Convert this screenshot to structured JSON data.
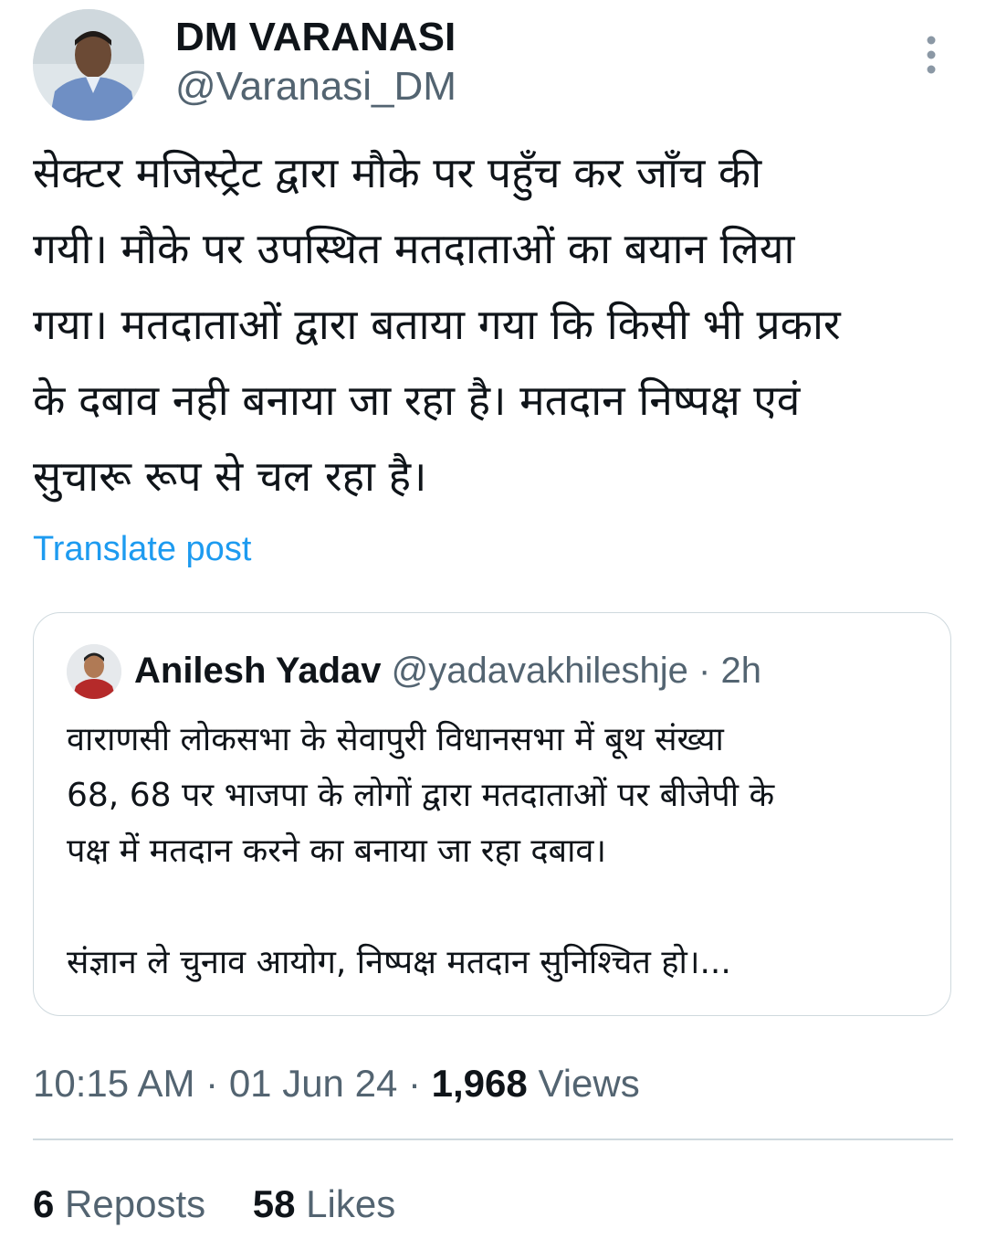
{
  "tweet": {
    "author": {
      "display_name": "DM VARANASI",
      "handle": "@Varanasi_DM",
      "avatar_icon": "profile-photo-icon"
    },
    "more_icon": "more-vertical-icon",
    "text": "सेक्टर मजिस्ट्रेट द्वारा मौके पर पहुँच कर जाँच की\nगयी। मौके पर उपस्थित मतदाताओं का बयान लिया\nगया। मतदाताओं द्वारा बताया गया कि किसी भी प्रकार\nके दबाव नही बनाया जा रहा है। मतदान निष्पक्ष एवं\nसुचारू रूप से चल रहा है।",
    "translate_label": "Translate post",
    "link_color": "#1d9bf0",
    "quoted": {
      "author_name": "Anilesh Yadav",
      "handle": "@yadavakhileshje",
      "separator": "·",
      "time": "2h",
      "avatar_icon": "profile-photo-icon",
      "text": "वाराणसी लोकसभा के सेवापुरी विधानसभा में बूथ संख्या\n68, 68 पर भाजपा के लोगों द्वारा मतदाताओं पर बीजेपी के\nपक्ष में मतदान करने का बनाया जा रहा दबाव।\n\nसंज्ञान ले चुनाव आयोग, निष्पक्ष मतदान सुनिश्चित हो।..."
    },
    "meta": {
      "time": "10:15 AM",
      "separator": "·",
      "date": "01 Jun 24",
      "views_count": "1,968",
      "views_label": "Views"
    },
    "stats": {
      "reposts_count": "6",
      "reposts_label": "Reposts",
      "likes_count": "58",
      "likes_label": "Likes"
    }
  }
}
